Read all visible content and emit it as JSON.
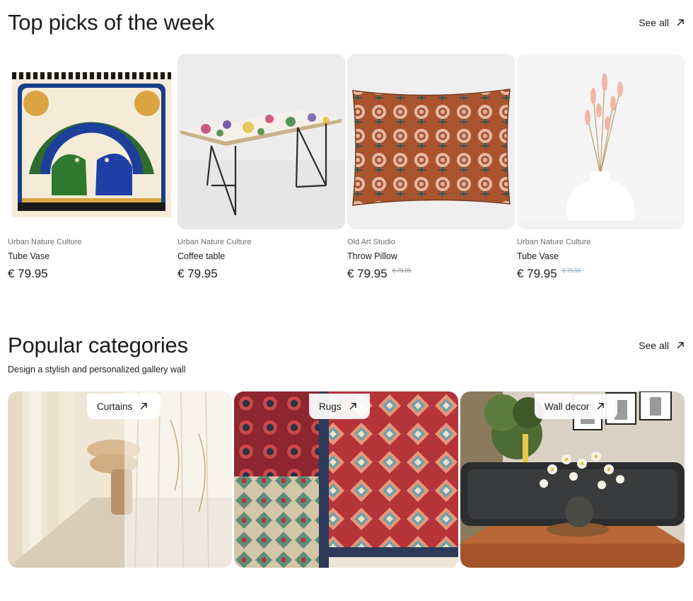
{
  "top_picks": {
    "title": "Top picks of the week",
    "see_all": "See all",
    "products": [
      {
        "brand": "Urban Nature Culture",
        "name": "Tube Vase",
        "price": "€ 79.95",
        "old_price": ""
      },
      {
        "brand": "Urban Nature Culture",
        "name": "Coffee table",
        "price": "€ 79.95",
        "old_price": ""
      },
      {
        "brand": "Old Art Studio",
        "name": "Throw Pillow",
        "price": "€ 79.95",
        "old_price": "€ 79.95"
      },
      {
        "brand": "Urban Nature Culture",
        "name": "Tube Vase",
        "price": "€ 79.95",
        "old_price": "€ 79.95"
      }
    ]
  },
  "popular": {
    "title": "Popular categories",
    "see_all": "See all",
    "subtitle": "Design a stylish and personalized gallery wall",
    "categories": [
      {
        "label": "Curtains"
      },
      {
        "label": "Rugs"
      },
      {
        "label": "Wall decor"
      }
    ]
  },
  "icons": {
    "see_all": "arrow-up-right-icon"
  },
  "colors": {
    "text": "#1b1b1b",
    "muted": "#6b6b6b",
    "strike_blue": "#8aa6c8"
  }
}
